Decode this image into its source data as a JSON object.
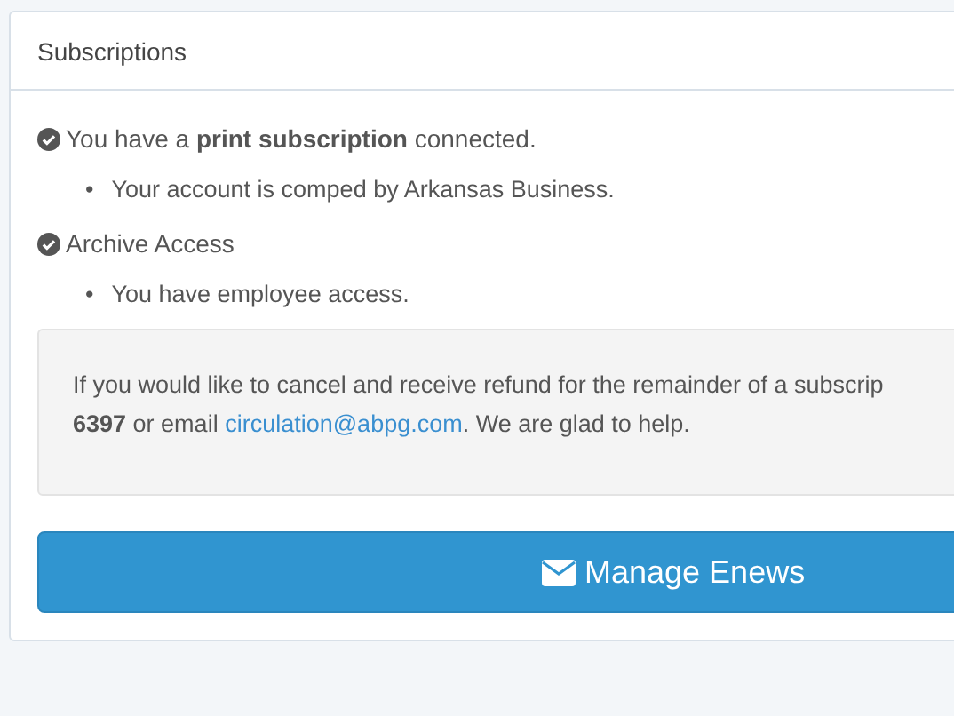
{
  "panel": {
    "title": "Subscriptions"
  },
  "items": [
    {
      "text": "You have a **print subscription** connected.",
      "bullets": [
        {
          "marker": "•",
          "text": "Your account is comped by Arkansas Business."
        }
      ]
    },
    {
      "text": "Archive Access",
      "bullets": [
        {
          "marker": "•",
          "text": "You have employee access."
        }
      ]
    }
  ],
  "note": {
    "line_1": "If you would like to cancel and receive refund for the remainder of a subscrip",
    "line_2_start": "**6397** or email ",
    "email_link": "circulation@abpg.com",
    "line_2_end": ". We are glad to help."
  },
  "button": {
    "label": "Manage Enews"
  }
}
